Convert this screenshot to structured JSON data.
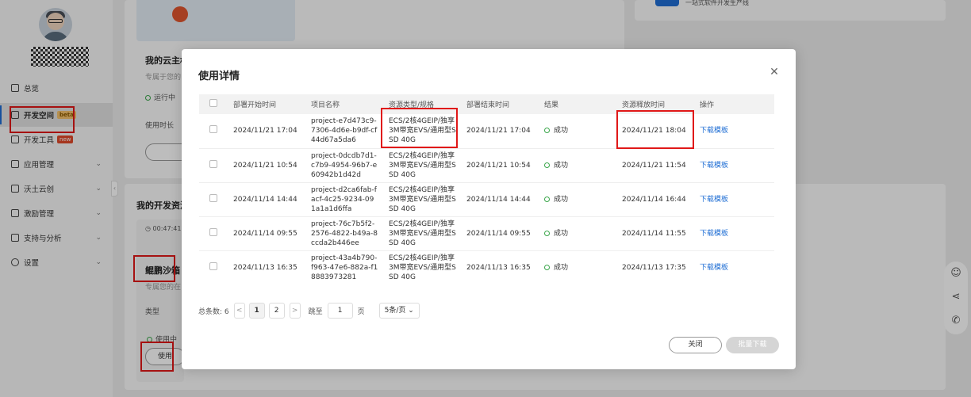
{
  "sidebar": {
    "items": [
      {
        "label": "总览",
        "badge": ""
      },
      {
        "label": "开发空间",
        "badge": "beta"
      },
      {
        "label": "开发工具",
        "badge": "new"
      },
      {
        "label": "应用管理",
        "badge": ""
      },
      {
        "label": "沃土云创",
        "badge": ""
      },
      {
        "label": "激励管理",
        "badge": ""
      },
      {
        "label": "支持与分析",
        "badge": ""
      },
      {
        "label": "设置",
        "badge": ""
      }
    ]
  },
  "background": {
    "cloud_card": {
      "title": "我的云主机",
      "subtitle": "专属于您的",
      "status": "运行中",
      "duration_label": "使用时长"
    },
    "dev_section_title": "我的开发资源",
    "resource_card": {
      "timer": "00:47:41",
      "name": "鲲鹏沙箱",
      "subtitle": "专属您的在",
      "type_label": "类型",
      "status": "使用中",
      "action": "使用"
    },
    "right_card_text": "一站式软件开发生产线"
  },
  "modal": {
    "title": "使用详情",
    "columns": [
      "部署开始时间",
      "项目名称",
      "资源类型/规格",
      "部署结束时间",
      "结果",
      "资源释放时间",
      "操作"
    ],
    "rows": [
      {
        "start": "2024/11/21 17:04",
        "project": "project-e7d473c9-7306-4d6e-b9df-cf44d67a5da6",
        "spec": "ECS/2核4GEIP/独享3M带宽EVS/通用型SSD 40G",
        "end": "2024/11/21 17:04",
        "result": "成功",
        "release": "2024/11/21 18:04",
        "action": "下载模板"
      },
      {
        "start": "2024/11/21 10:54",
        "project": "project-0dcdb7d1-c7b9-4954-96b7-e60942b1d42d",
        "spec": "ECS/2核4GEIP/独享3M带宽EVS/通用型SSD 40G",
        "end": "2024/11/21 10:54",
        "result": "成功",
        "release": "2024/11/21 11:54",
        "action": "下载模板"
      },
      {
        "start": "2024/11/14 14:44",
        "project": "project-d2ca6fab-facf-4c25-9234-091a1a1d6ffa",
        "spec": "ECS/2核4GEIP/独享3M带宽EVS/通用型SSD 40G",
        "end": "2024/11/14 14:44",
        "result": "成功",
        "release": "2024/11/14 16:44",
        "action": "下载模板"
      },
      {
        "start": "2024/11/14 09:55",
        "project": "project-76c7b5f2-2576-4822-b49a-8ccda2b446ee",
        "spec": "ECS/2核4GEIP/独享3M带宽EVS/通用型SSD 40G",
        "end": "2024/11/14 09:55",
        "result": "成功",
        "release": "2024/11/14 11:55",
        "action": "下载模板"
      },
      {
        "start": "2024/11/13 16:35",
        "project": "project-43a4b790-f963-47e6-882a-f18883973281",
        "spec": "ECS/2核4GEIP/独享3M带宽EVS/通用型SSD 40G",
        "end": "2024/11/13 16:35",
        "result": "成功",
        "release": "2024/11/13 17:35",
        "action": "下载模板"
      }
    ],
    "pager": {
      "total_label": "总条数: 6",
      "pages": [
        "1",
        "2"
      ],
      "prev": "<",
      "next": ">",
      "jump_label": "跳至",
      "jump_value": "1",
      "page_unit": "页",
      "page_size": "5条/页"
    },
    "close_button": "关闭",
    "batch_button": "批量下载"
  },
  "colors": {
    "accent": "#1f6ed4",
    "success": "#3aa64a",
    "highlight": "#e01818"
  }
}
